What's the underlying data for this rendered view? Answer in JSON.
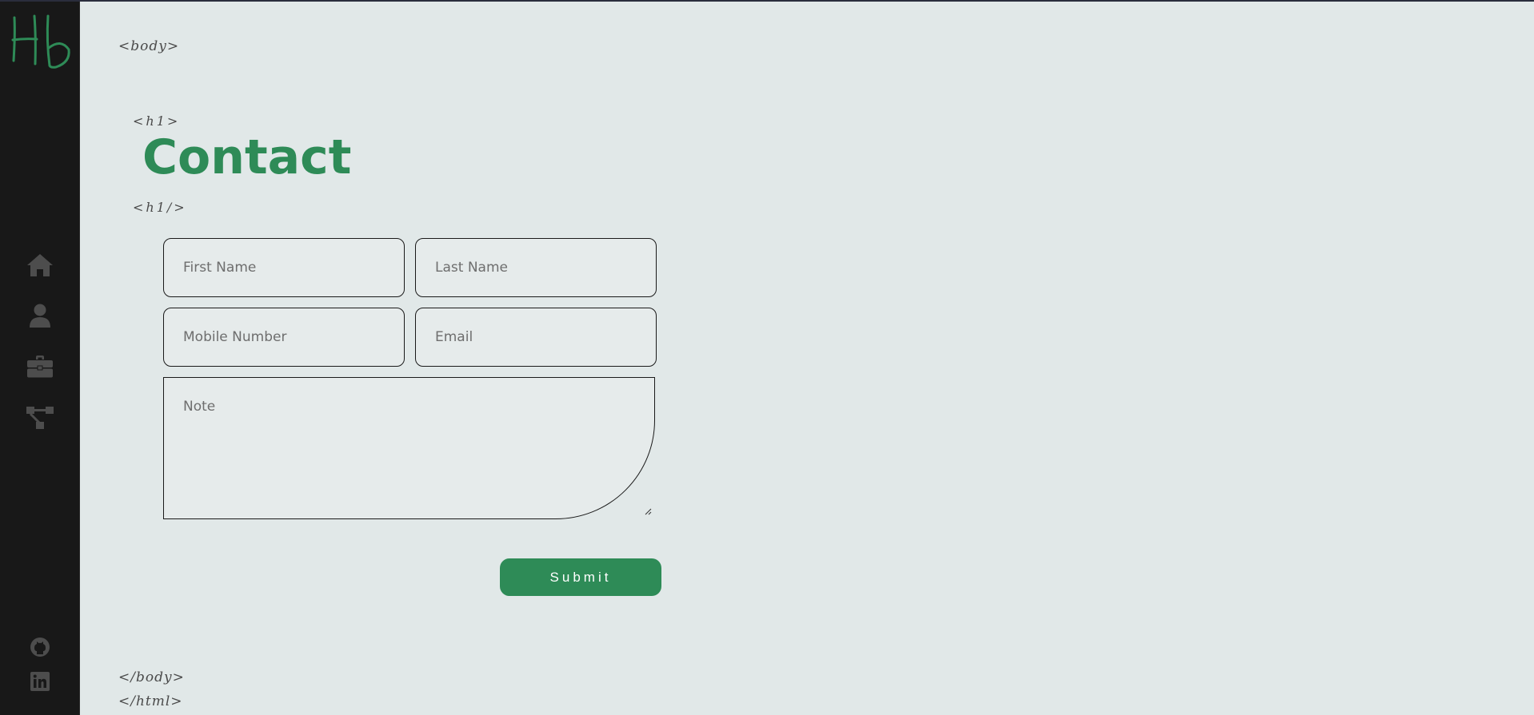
{
  "brand": {
    "logo_text": "Hb",
    "accent_color": "#2e8b57",
    "sidebar_bg": "#181818",
    "page_bg": "#e1e8e8"
  },
  "sidebar": {
    "nav": [
      {
        "name": "home",
        "icon": "home-icon"
      },
      {
        "name": "about",
        "icon": "user-icon"
      },
      {
        "name": "portfolio",
        "icon": "briefcase-icon"
      },
      {
        "name": "skills",
        "icon": "network-icon"
      }
    ],
    "social": [
      {
        "name": "github",
        "icon": "github-icon"
      },
      {
        "name": "linkedin",
        "icon": "linkedin-icon"
      }
    ]
  },
  "tags": {
    "body_open": "<body>",
    "h1_open": "<h1>",
    "h1_close": "<h1/>",
    "body_close": "</body>",
    "html_close": "</html>"
  },
  "page": {
    "title": "Contact"
  },
  "form": {
    "first_name": {
      "placeholder": "First Name",
      "value": ""
    },
    "last_name": {
      "placeholder": "Last Name",
      "value": ""
    },
    "mobile": {
      "placeholder": "Mobile Number",
      "value": ""
    },
    "email": {
      "placeholder": "Email",
      "value": ""
    },
    "note": {
      "placeholder": "Note",
      "value": ""
    },
    "submit_label": "Submit"
  }
}
